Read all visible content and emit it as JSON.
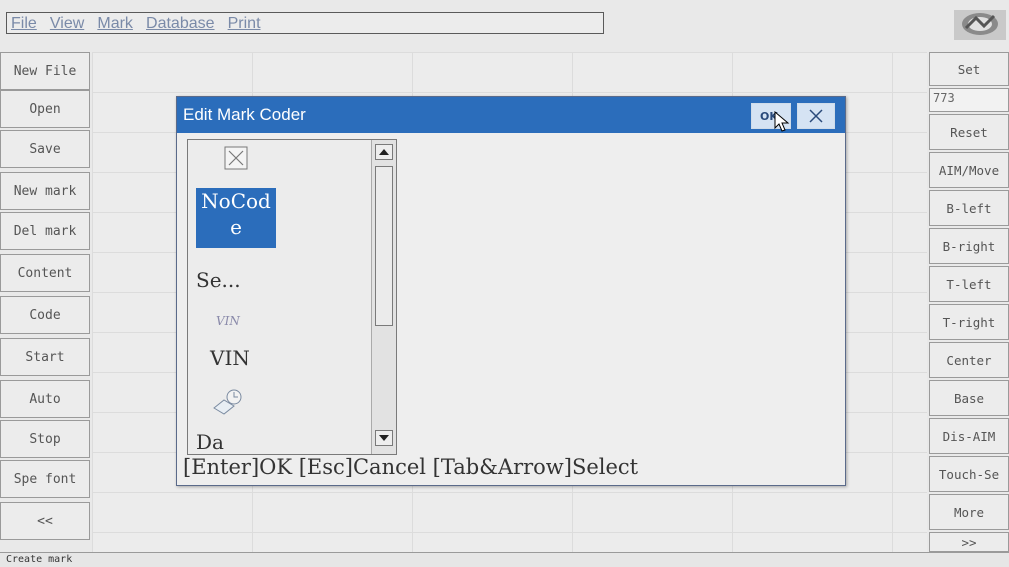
{
  "menubar": {
    "items": [
      {
        "label": "File"
      },
      {
        "label": "View"
      },
      {
        "label": "Mark"
      },
      {
        "label": "Database"
      },
      {
        "label": "Print"
      }
    ]
  },
  "left_toolbar": {
    "buttons": [
      {
        "label": "New File"
      },
      {
        "label": "Open"
      },
      {
        "label": "Save"
      },
      {
        "label": "New mark"
      },
      {
        "label": "Del mark"
      },
      {
        "label": "Content"
      },
      {
        "label": "Code"
      },
      {
        "label": "Start"
      },
      {
        "label": "Auto"
      },
      {
        "label": "Stop"
      },
      {
        "label": "Spe font"
      },
      {
        "label": "<<"
      }
    ]
  },
  "right_toolbar": {
    "set_label": "Set",
    "value": "773",
    "buttons": [
      {
        "label": "Reset"
      },
      {
        "label": "AIM/Move"
      },
      {
        "label": "B-left"
      },
      {
        "label": "B-right"
      },
      {
        "label": "T-left"
      },
      {
        "label": "T-right"
      },
      {
        "label": "Center"
      },
      {
        "label": "Base"
      },
      {
        "label": "Dis-AIM"
      },
      {
        "label": "Touch-Se"
      },
      {
        "label": "More"
      },
      {
        "label": ">>"
      }
    ]
  },
  "dialog": {
    "title": "Edit Mark Coder",
    "ok_label": "OK",
    "list": {
      "selected_line1": "NoCod",
      "selected_line2": "e",
      "items": [
        {
          "label": "Se...",
          "icon": "barcode-icon"
        },
        {
          "label": "VIN",
          "icon": "vin-icon"
        },
        {
          "label": "Da",
          "icon": "date-clock-icon"
        }
      ]
    },
    "hint": "[Enter]OK [Esc]Cancel [Tab&Arrow]Select"
  },
  "status": {
    "text": "Create mark"
  },
  "colors": {
    "titlebar": "#2b6dbb",
    "selection": "#2b6dbb",
    "background": "#ececec"
  }
}
